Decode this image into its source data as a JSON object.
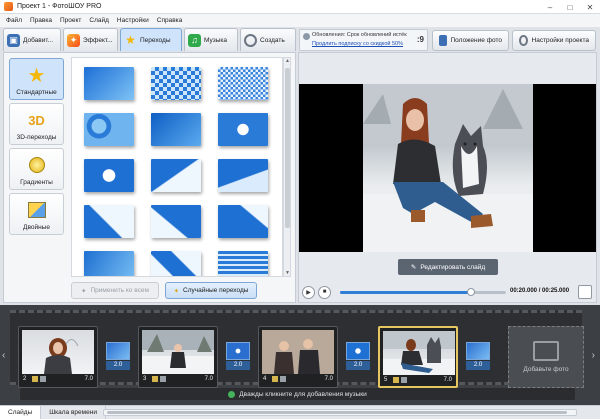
{
  "window": {
    "title": "Проект 1 - ФотоШОУ PRO"
  },
  "menu": [
    "Файл",
    "Правка",
    "Проект",
    "Слайд",
    "Настройки",
    "Справка"
  ],
  "tabs": [
    {
      "label": "Добавит...",
      "icon": "folder-icon"
    },
    {
      "label": "Эффект...",
      "icon": "effects-icon"
    },
    {
      "label": "Переходы",
      "icon": "star-icon",
      "active": true
    },
    {
      "label": "Музыка",
      "icon": "music-icon"
    },
    {
      "label": "Создать",
      "icon": "film-reel-icon"
    }
  ],
  "notice": {
    "line1": "Обновления: Срок обновлений истёк",
    "line2": "Продлить подписку со скидкой 50%",
    "num": ":9"
  },
  "toolbar": {
    "photo_position": "Положение фото",
    "project_settings": "Настройки проекта"
  },
  "categories": [
    {
      "label": "Стандартные",
      "icon": "star-icon",
      "active": true
    },
    {
      "label": "3D-переходы",
      "icon": "3d-icon"
    },
    {
      "label": "Градиенты",
      "icon": "gradient-icon"
    },
    {
      "label": "Двойные",
      "icon": "double-icon"
    }
  ],
  "transitions_count": 15,
  "buttons": {
    "apply_all": "Применить ко всем",
    "random": "Случайные переходы",
    "edit_slide": "Редактировать слайд"
  },
  "player": {
    "current": "00:20.000",
    "total": "00:25.000",
    "progress": 0.79
  },
  "slides": [
    {
      "num": "2",
      "dur": "7.0"
    },
    {
      "num": "3",
      "dur": "7.0"
    },
    {
      "num": "4",
      "dur": "7.0"
    },
    {
      "num": "5",
      "dur": "7.0",
      "active": true
    }
  ],
  "transitions_timeline": [
    "2.0",
    "2.0",
    "2.0",
    "2.0"
  ],
  "add_photo": "Добавьте фото",
  "music_hint": "Дважды кликните для добавления музыки",
  "bottom_tabs": [
    {
      "label": "Слайды",
      "active": true
    },
    {
      "label": "Шкала времени"
    }
  ],
  "colors": {
    "accent": "#2f7fd6",
    "active_slide_border": "#e6c661",
    "transition_blue": "#2a6fd0"
  }
}
